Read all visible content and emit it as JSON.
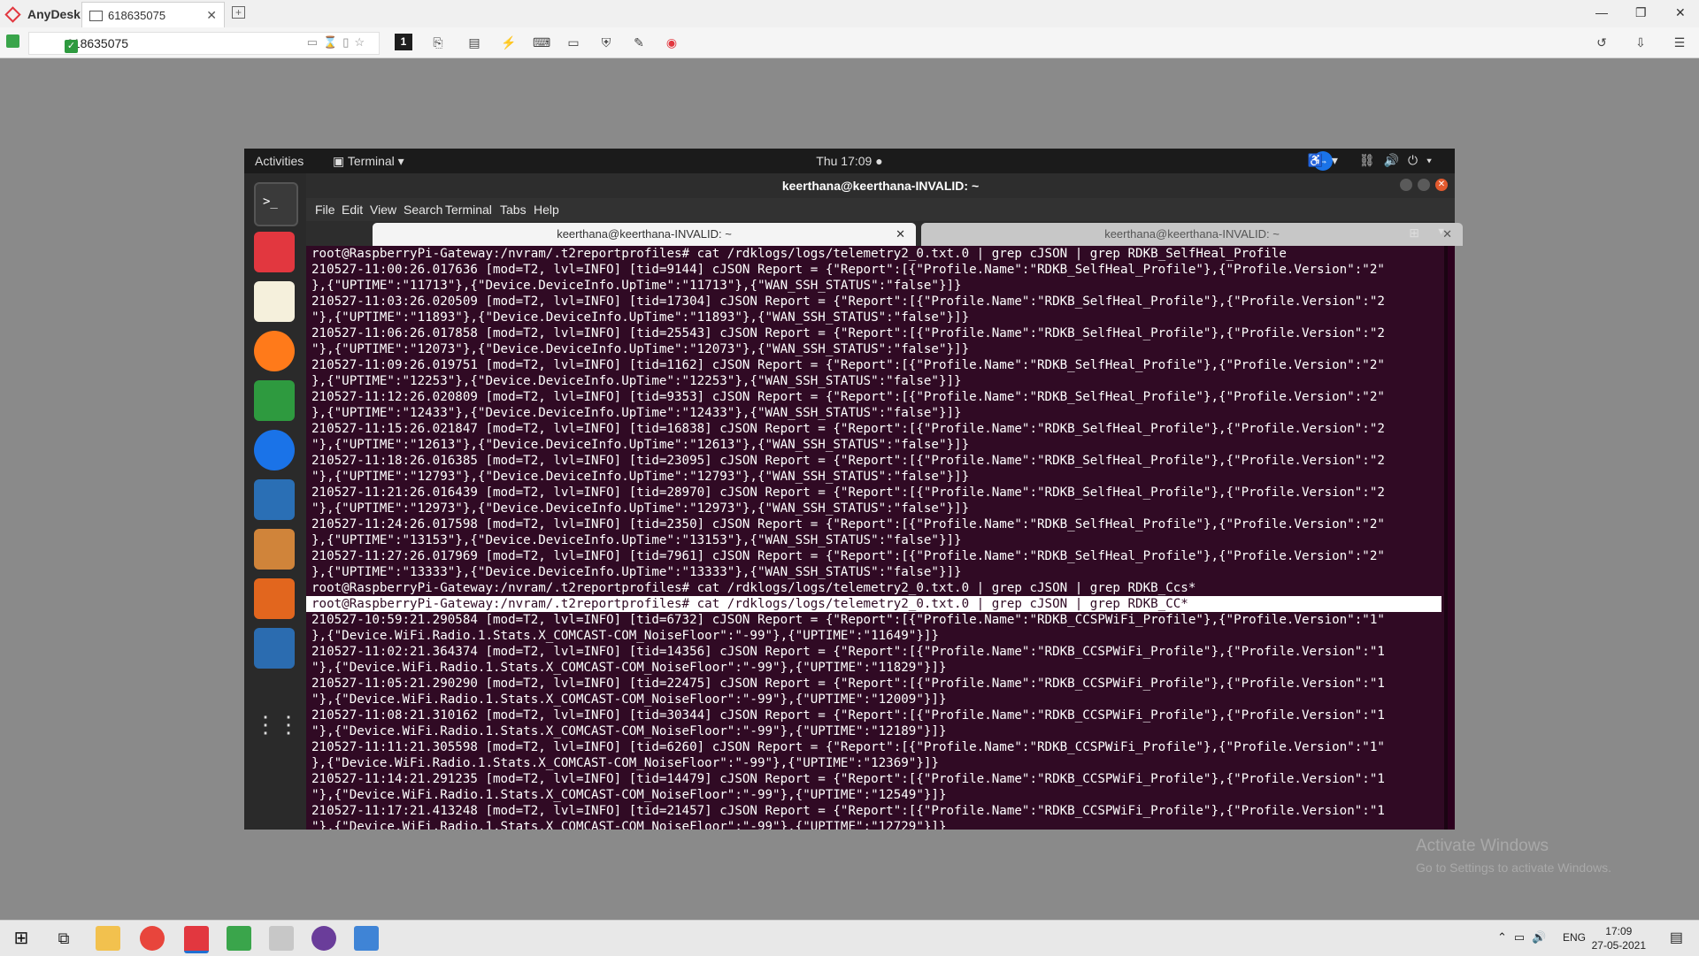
{
  "anydesk": {
    "brand": "AnyDesk",
    "tab_title": "618635075",
    "address": "618635075",
    "display_number": "1"
  },
  "gnome": {
    "activities": "Activities",
    "app_menu": "Terminal ▾",
    "clock": "Thu 17:09 ●"
  },
  "window": {
    "title": "keerthana@keerthana-INVALID: ~",
    "menu": [
      "File",
      "Edit",
      "View",
      "Search",
      "Terminal",
      "Tabs",
      "Help"
    ],
    "tabs": [
      "keerthana@keerthana-INVALID: ~",
      "keerthana@keerthana-INVALID: ~"
    ]
  },
  "terminal_lines": [
    "root@RaspberryPi-Gateway:/nvram/.t2reportprofiles# cat /rdklogs/logs/telemetry2_0.txt.0 | grep cJSON | grep RDKB_SelfHeal_Profile",
    "210527-11:00:26.017636 [mod=T2, lvl=INFO] [tid=9144] cJSON Report = {\"Report\":[{\"Profile.Name\":\"RDKB_SelfHeal_Profile\"},{\"Profile.Version\":\"2\"",
    "},{\"UPTIME\":\"11713\"},{\"Device.DeviceInfo.UpTime\":\"11713\"},{\"WAN_SSH_STATUS\":\"false\"}]}",
    "210527-11:03:26.020509 [mod=T2, lvl=INFO] [tid=17304] cJSON Report = {\"Report\":[{\"Profile.Name\":\"RDKB_SelfHeal_Profile\"},{\"Profile.Version\":\"2",
    "\"},{\"UPTIME\":\"11893\"},{\"Device.DeviceInfo.UpTime\":\"11893\"},{\"WAN_SSH_STATUS\":\"false\"}]}",
    "210527-11:06:26.017858 [mod=T2, lvl=INFO] [tid=25543] cJSON Report = {\"Report\":[{\"Profile.Name\":\"RDKB_SelfHeal_Profile\"},{\"Profile.Version\":\"2",
    "\"},{\"UPTIME\":\"12073\"},{\"Device.DeviceInfo.UpTime\":\"12073\"},{\"WAN_SSH_STATUS\":\"false\"}]}",
    "210527-11:09:26.019751 [mod=T2, lvl=INFO] [tid=1162] cJSON Report = {\"Report\":[{\"Profile.Name\":\"RDKB_SelfHeal_Profile\"},{\"Profile.Version\":\"2\"",
    "},{\"UPTIME\":\"12253\"},{\"Device.DeviceInfo.UpTime\":\"12253\"},{\"WAN_SSH_STATUS\":\"false\"}]}",
    "210527-11:12:26.020809 [mod=T2, lvl=INFO] [tid=9353] cJSON Report = {\"Report\":[{\"Profile.Name\":\"RDKB_SelfHeal_Profile\"},{\"Profile.Version\":\"2\"",
    "},{\"UPTIME\":\"12433\"},{\"Device.DeviceInfo.UpTime\":\"12433\"},{\"WAN_SSH_STATUS\":\"false\"}]}",
    "210527-11:15:26.021847 [mod=T2, lvl=INFO] [tid=16838] cJSON Report = {\"Report\":[{\"Profile.Name\":\"RDKB_SelfHeal_Profile\"},{\"Profile.Version\":\"2",
    "\"},{\"UPTIME\":\"12613\"},{\"Device.DeviceInfo.UpTime\":\"12613\"},{\"WAN_SSH_STATUS\":\"false\"}]}",
    "210527-11:18:26.016385 [mod=T2, lvl=INFO] [tid=23095] cJSON Report = {\"Report\":[{\"Profile.Name\":\"RDKB_SelfHeal_Profile\"},{\"Profile.Version\":\"2",
    "\"},{\"UPTIME\":\"12793\"},{\"Device.DeviceInfo.UpTime\":\"12793\"},{\"WAN_SSH_STATUS\":\"false\"}]}",
    "210527-11:21:26.016439 [mod=T2, lvl=INFO] [tid=28970] cJSON Report = {\"Report\":[{\"Profile.Name\":\"RDKB_SelfHeal_Profile\"},{\"Profile.Version\":\"2",
    "\"},{\"UPTIME\":\"12973\"},{\"Device.DeviceInfo.UpTime\":\"12973\"},{\"WAN_SSH_STATUS\":\"false\"}]}",
    "210527-11:24:26.017598 [mod=T2, lvl=INFO] [tid=2350] cJSON Report = {\"Report\":[{\"Profile.Name\":\"RDKB_SelfHeal_Profile\"},{\"Profile.Version\":\"2\"",
    "},{\"UPTIME\":\"13153\"},{\"Device.DeviceInfo.UpTime\":\"13153\"},{\"WAN_SSH_STATUS\":\"false\"}]}",
    "210527-11:27:26.017969 [mod=T2, lvl=INFO] [tid=7961] cJSON Report = {\"Report\":[{\"Profile.Name\":\"RDKB_SelfHeal_Profile\"},{\"Profile.Version\":\"2\"",
    "},{\"UPTIME\":\"13333\"},{\"Device.DeviceInfo.UpTime\":\"13333\"},{\"WAN_SSH_STATUS\":\"false\"}]}",
    "root@RaspberryPi-Gateway:/nvram/.t2reportprofiles# cat /rdklogs/logs/telemetry2_0.txt.0 | grep cJSON | grep RDKB_Ccs*",
    "root@RaspberryPi-Gateway:/nvram/.t2reportprofiles# cat /rdklogs/logs/telemetry2_0.txt.0 | grep cJSON | grep RDKB_CC*",
    "210527-10:59:21.290584 [mod=T2, lvl=INFO] [tid=6732] cJSON Report = {\"Report\":[{\"Profile.Name\":\"RDKB_CCSPWiFi_Profile\"},{\"Profile.Version\":\"1\"",
    "},{\"Device.WiFi.Radio.1.Stats.X_COMCAST-COM_NoiseFloor\":\"-99\"},{\"UPTIME\":\"11649\"}]}",
    "210527-11:02:21.364374 [mod=T2, lvl=INFO] [tid=14356] cJSON Report = {\"Report\":[{\"Profile.Name\":\"RDKB_CCSPWiFi_Profile\"},{\"Profile.Version\":\"1",
    "\"},{\"Device.WiFi.Radio.1.Stats.X_COMCAST-COM_NoiseFloor\":\"-99\"},{\"UPTIME\":\"11829\"}]}",
    "210527-11:05:21.290290 [mod=T2, lvl=INFO] [tid=22475] cJSON Report = {\"Report\":[{\"Profile.Name\":\"RDKB_CCSPWiFi_Profile\"},{\"Profile.Version\":\"1",
    "\"},{\"Device.WiFi.Radio.1.Stats.X_COMCAST-COM_NoiseFloor\":\"-99\"},{\"UPTIME\":\"12009\"}]}",
    "210527-11:08:21.310162 [mod=T2, lvl=INFO] [tid=30344] cJSON Report = {\"Report\":[{\"Profile.Name\":\"RDKB_CCSPWiFi_Profile\"},{\"Profile.Version\":\"1",
    "\"},{\"Device.WiFi.Radio.1.Stats.X_COMCAST-COM_NoiseFloor\":\"-99\"},{\"UPTIME\":\"12189\"}]}",
    "210527-11:11:21.305598 [mod=T2, lvl=INFO] [tid=6260] cJSON Report = {\"Report\":[{\"Profile.Name\":\"RDKB_CCSPWiFi_Profile\"},{\"Profile.Version\":\"1\"",
    "},{\"Device.WiFi.Radio.1.Stats.X_COMCAST-COM_NoiseFloor\":\"-99\"},{\"UPTIME\":\"12369\"}]}",
    "210527-11:14:21.291235 [mod=T2, lvl=INFO] [tid=14479] cJSON Report = {\"Report\":[{\"Profile.Name\":\"RDKB_CCSPWiFi_Profile\"},{\"Profile.Version\":\"1",
    "\"},{\"Device.WiFi.Radio.1.Stats.X_COMCAST-COM_NoiseFloor\":\"-99\"},{\"UPTIME\":\"12549\"}]}",
    "210527-11:17:21.413248 [mod=T2, lvl=INFO] [tid=21457] cJSON Report = {\"Report\":[{\"Profile.Name\":\"RDKB_CCSPWiFi_Profile\"},{\"Profile.Version\":\"1",
    "\"},{\"Device.WiFi.Radio.1.Stats.X_COMCAST-COM_NoiseFloor\":\"-99\"},{\"UPTIME\":\"12729\"}]}"
  ],
  "selected_line_index": 22,
  "watermark": {
    "title": "Activate Windows",
    "subtitle": "Go to Settings to activate Windows."
  },
  "taskbar": {
    "language": "ENG",
    "time": "17:09",
    "date": "27-05-2021"
  }
}
